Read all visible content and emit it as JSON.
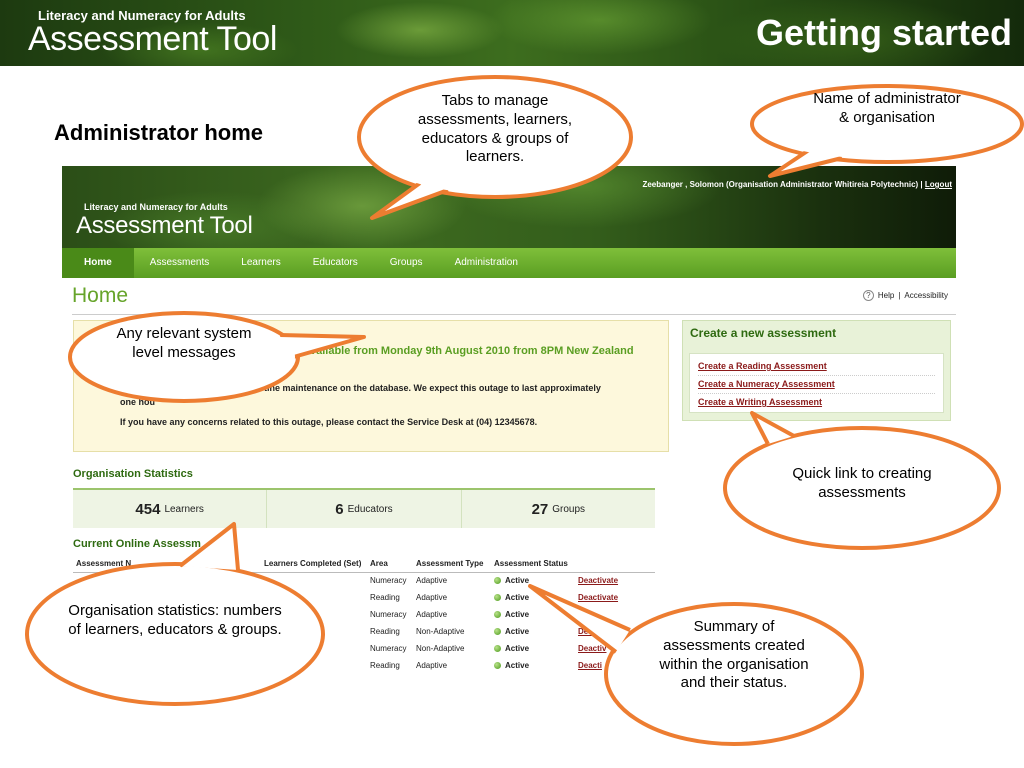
{
  "slide": {
    "banner_logo_small": "Literacy and Numeracy for Adults",
    "banner_logo_large": "Assessment Tool",
    "title": "Getting started",
    "heading": "Administrator home"
  },
  "app": {
    "logo_small": "Literacy and Numeracy for Adults",
    "logo_large": "Assessment Tool",
    "user_info": "Zeebanger , Solomon (Organisation Administrator Whitireia Polytechnic) |",
    "logout_label": "Logout",
    "nav": [
      "Home",
      "Assessments",
      "Learners",
      "Educators",
      "Groups",
      "Administration"
    ],
    "page_title": "Home",
    "help_label": "Help",
    "accessibility_label": "Accessibility",
    "message": {
      "headline_fragment": "vailable from Monday 9th August 2010 from 8PM New Zealand",
      "line1_fragment": "tine maintenance on the database. We expect this outage to last approximately",
      "line2_fragment": "one hou",
      "line3": "If you have any concerns related to this outage, please contact the Service Desk at (04) 12345678."
    },
    "create_panel": {
      "heading": "Create a new assessment",
      "links": [
        "Create a Reading Assessment",
        "Create a Numeracy Assessment",
        "Create a Writing Assessment"
      ]
    },
    "stats": {
      "heading": "Organisation Statistics",
      "items": [
        {
          "value": "454",
          "label": "Learners"
        },
        {
          "value": "6",
          "label": "Educators"
        },
        {
          "value": "27",
          "label": "Groups"
        }
      ]
    },
    "online": {
      "heading": "Current Online Assessm",
      "columns": [
        "Assessment N",
        "Learners Completed (Set)",
        "Area",
        "Assessment Type",
        "Assessment Status",
        ""
      ],
      "rows": [
        {
          "name": "",
          "completed": "",
          "area": "Numeracy",
          "type": "Adaptive",
          "status": "Active",
          "action": "Deactivate"
        },
        {
          "name": "",
          "completed": "",
          "area": "Reading",
          "type": "Adaptive",
          "status": "Active",
          "action": "Deactivate"
        },
        {
          "name": "",
          "completed": "",
          "area": "Numeracy",
          "type": "Adaptive",
          "status": "Active",
          "action": ""
        },
        {
          "name": "",
          "completed": "",
          "area": "Reading",
          "type": "Non-Adaptive",
          "status": "Active",
          "action": "Deacti"
        },
        {
          "name": "",
          "completed": "",
          "area": "Numeracy",
          "type": "Non-Adaptive",
          "status": "Active",
          "action": "Deactiv"
        },
        {
          "name": "",
          "completed": "",
          "area": "Reading",
          "type": "Adaptive",
          "status": "Active",
          "action": "Deacti"
        }
      ]
    }
  },
  "callouts": {
    "tabs": "Tabs to manage assessments, learners, educators & groups of learners.",
    "admin": "Name of administrator & organisation",
    "messages": "Any relevant system level messages",
    "quicklink": "Quick link to creating assessments",
    "stats": "Organisation statistics: numbers of learners, educators & groups.",
    "summary": "Summary of assessments created within the organisation and their status."
  },
  "colors": {
    "callout_border": "#ed7d31",
    "nav_green": "#6aad2c",
    "heading_green": "#2e6a10",
    "link_red": "#8b1a1a"
  }
}
